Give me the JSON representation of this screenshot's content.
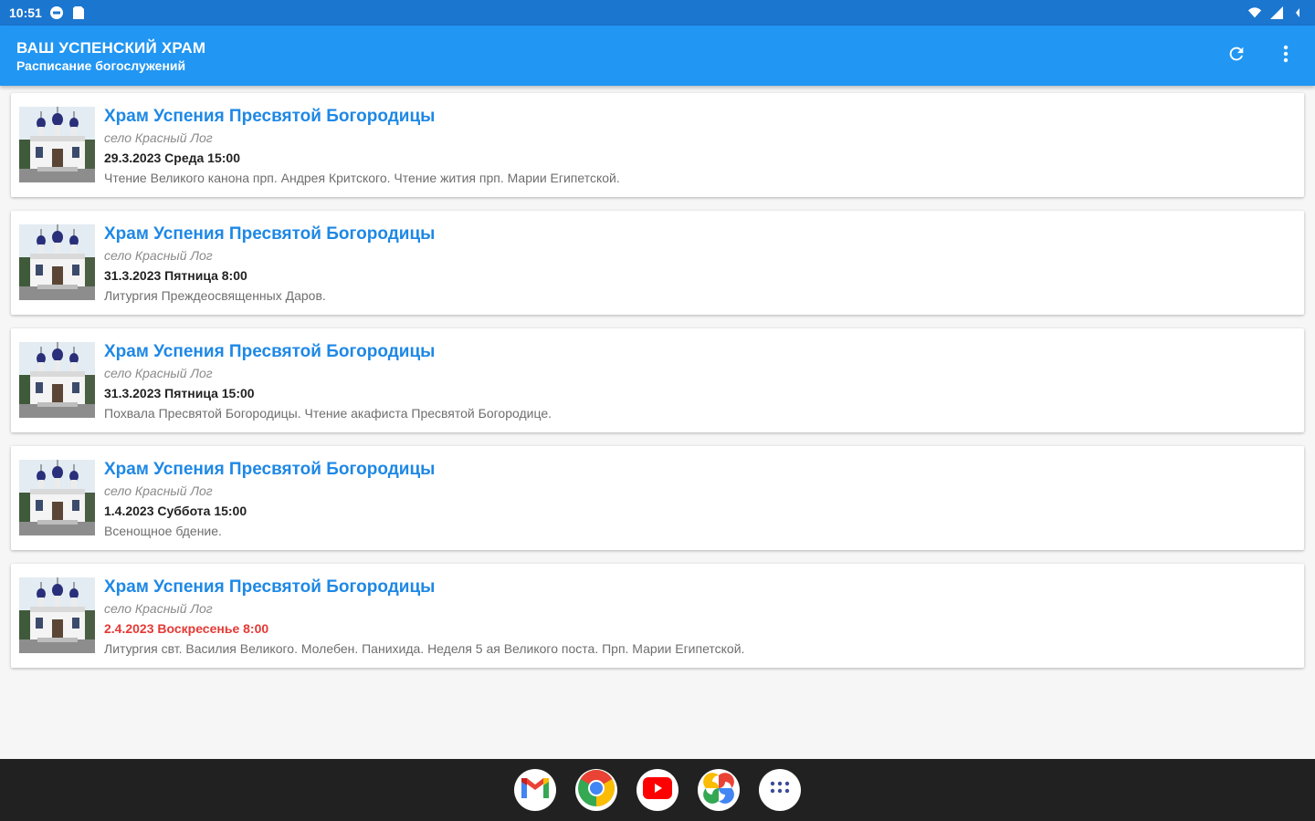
{
  "status_bar": {
    "time": "10:51",
    "icons": [
      "notification-icon",
      "sim-card-icon",
      "wifi-icon",
      "signal-icon",
      "battery-icon"
    ]
  },
  "app_bar": {
    "title": "ВАШ УСПЕНСКИЙ ХРАМ",
    "subtitle": "Расписание богослужений",
    "actions": [
      "refresh-icon",
      "more-vert-icon"
    ]
  },
  "schedule": [
    {
      "title": "Храм Успения Пресвятой Богородицы",
      "place": "село Красный Лог",
      "date": "29.3.2023  Среда 15:00",
      "description": "Чтение Великого канона прп. Андрея Критского. Чтение жития прп. Марии Египетской.",
      "holiday": false
    },
    {
      "title": "Храм Успения Пресвятой Богородицы",
      "place": "село Красный Лог",
      "date": "31.3.2023  Пятница 8:00",
      "description": "Литургия Преждеосвященных Даров.",
      "holiday": false
    },
    {
      "title": "Храм Успения Пресвятой Богородицы",
      "place": "село Красный Лог",
      "date": "31.3.2023  Пятница 15:00",
      "description": "Похвала Пресвятой Богородицы. Чтение акафиста Пресвятой Богородице.",
      "holiday": false
    },
    {
      "title": "Храм Успения Пресвятой Богородицы",
      "place": "село Красный Лог",
      "date": "1.4.2023  Суббота 15:00",
      "description": "Всенощное бдение.",
      "holiday": false
    },
    {
      "title": "Храм Успения Пресвятой Богородицы",
      "place": "село Красный Лог",
      "date": "2.4.2023  Воскресенье 8:00",
      "description": "Литургия свт. Василия Великого. Молебен. Панихида. Неделя 5 ая Великого поста. Прп. Марии Египетской.",
      "holiday": true
    }
  ],
  "dock": {
    "apps": [
      "gmail-icon",
      "chrome-icon",
      "youtube-icon",
      "photos-icon",
      "app-drawer-icon"
    ]
  },
  "colors": {
    "status_bar": "#1b76d0",
    "app_bar": "#2196f3",
    "title_link": "#1e88e5",
    "holiday_date": "#e53935",
    "dock": "#212121"
  }
}
